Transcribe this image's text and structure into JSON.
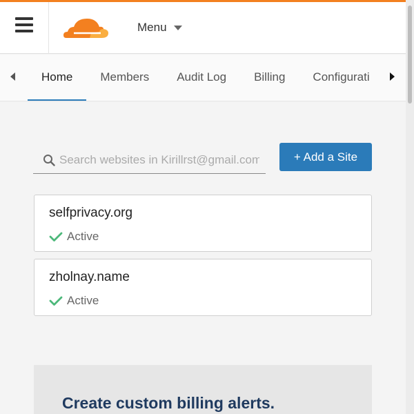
{
  "header": {
    "menu_label": "Menu",
    "brand_color": "#f38020"
  },
  "tabs": {
    "items": [
      {
        "label": "Home",
        "active": true
      },
      {
        "label": "Members",
        "active": false
      },
      {
        "label": "Audit Log",
        "active": false
      },
      {
        "label": "Billing",
        "active": false
      },
      {
        "label": "Configurati",
        "active": false
      }
    ],
    "accent": "#2b7bb9"
  },
  "search": {
    "placeholder": "Search websites in Kirillrst@gmail.com",
    "value": ""
  },
  "add_site": {
    "label": "+ Add a Site"
  },
  "sites": [
    {
      "name": "selfprivacy.org",
      "status": "Active"
    },
    {
      "name": "zholnay.name",
      "status": "Active"
    }
  ],
  "alert": {
    "title": "Create custom billing alerts."
  },
  "icons": {
    "menu": "hamburger-icon",
    "logo": "cloudflare-logo",
    "search": "search-icon",
    "status": "check-icon",
    "tabs_prev": "chevron-left-icon",
    "tabs_next": "chevron-right-icon",
    "menu_caret": "caret-down-icon"
  }
}
